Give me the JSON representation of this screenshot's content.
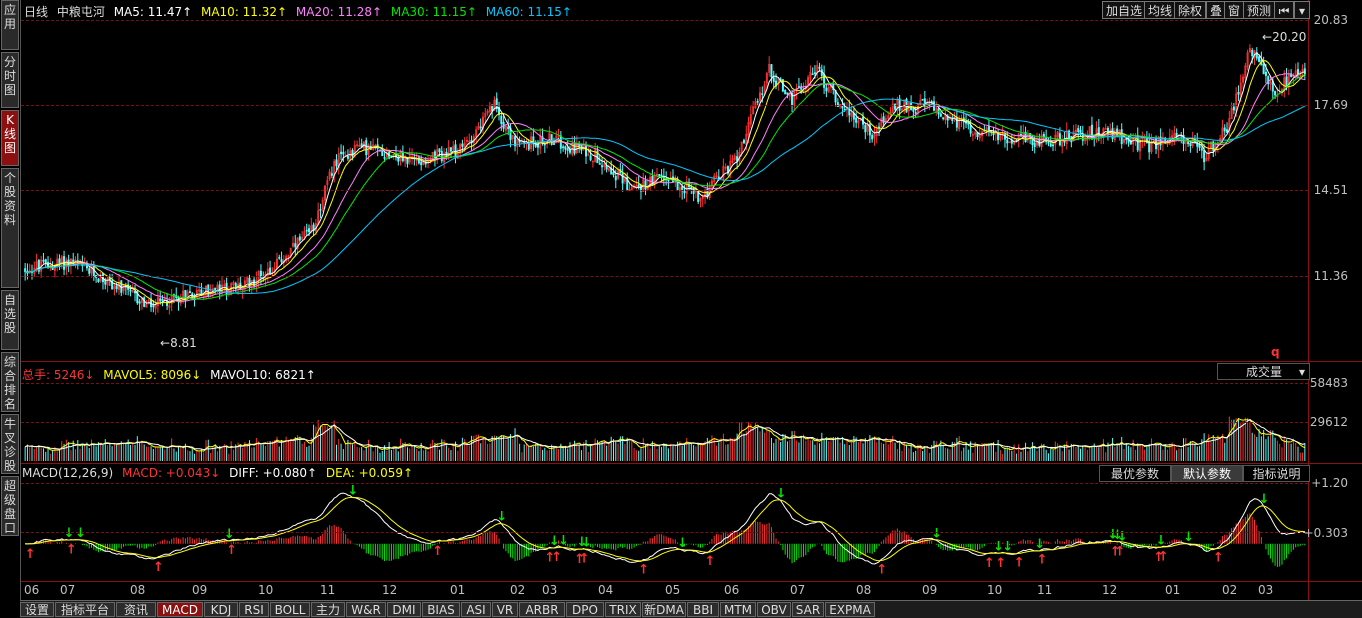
{
  "left_tabs": [
    {
      "label": "应用",
      "name": "tab-apply",
      "active": false
    },
    {
      "label": "分时图",
      "name": "tab-timeshare",
      "active": false
    },
    {
      "label": "K线图",
      "name": "tab-kline",
      "active": true
    },
    {
      "label": "个股资料",
      "name": "tab-stock-info",
      "active": false
    },
    {
      "label": "自选股",
      "name": "tab-watchlist",
      "active": false
    },
    {
      "label": "综合排名",
      "name": "tab-ranking",
      "active": false
    },
    {
      "label": "牛叉诊股",
      "name": "tab-diagnosis",
      "active": false
    },
    {
      "label": "超级盘口",
      "name": "tab-super-quote",
      "active": false
    }
  ],
  "header": {
    "period": "日线",
    "stock_name": "中粮屯河",
    "ma5": "MA5: 11.47↑",
    "ma10": "MA10: 11.32↑",
    "ma20": "MA20: 11.28↑",
    "ma30": "MA30: 11.15↑",
    "ma60": "MA60: 11.15↑"
  },
  "toolbar": {
    "add_watch": "加自选",
    "ma_line": "均线",
    "ex_rights": "除权",
    "overlay": "叠",
    "window": "窗",
    "forecast": "预测",
    "first_icon": "skip-first-icon",
    "dropdown_icon": "chevron-down-icon"
  },
  "price_axis": [
    "20.83",
    "17.69",
    "14.51",
    "11.36"
  ],
  "price_marks": {
    "high": "20.20",
    "low": "8.81",
    "q": "q"
  },
  "volume": {
    "total": "总手: 5246↓",
    "mavol5": "MAVOL5: 8096↓",
    "mavol10": "MAVOL10: 6821↑",
    "selector": "成交量",
    "axis": [
      "58483",
      "29612"
    ]
  },
  "macd": {
    "title": "MACD(12,26,9)",
    "macd": "MACD: +0.043↓",
    "diff": "DIFF: +0.080↑",
    "dea": "DEA: +0.059↑",
    "axis": [
      "+1.20",
      "+0.303"
    ],
    "btn_best": "最优参数",
    "btn_default": "默认参数",
    "btn_help": "指标说明"
  },
  "x_axis": [
    "06",
    "07",
    "08",
    "09",
    "10",
    "11",
    "12",
    "01",
    "02",
    "03",
    "04",
    "05",
    "06",
    "07",
    "08",
    "09",
    "10",
    "11",
    "12",
    "01",
    "02",
    "03"
  ],
  "bottom_tabs": [
    "设置",
    "指标平台",
    "资讯",
    "MACD",
    "KDJ",
    "RSI",
    "BOLL",
    "主力",
    "W&R",
    "DMI",
    "BIAS",
    "ASI",
    "VR",
    "ARBR",
    "DPO",
    "TRIX",
    "新DMA",
    "BBI",
    "MTM",
    "OBV",
    "SAR",
    "EXPMA"
  ],
  "bottom_active": "MACD",
  "colors": {
    "up": "#ff3232",
    "down": "#54ffff",
    "ma5": "#ffffff",
    "ma10": "#ffff00",
    "ma20": "#ff80ff",
    "ma30": "#00e600",
    "ma60": "#00c8ff",
    "grid": "#7a1010"
  },
  "chart_data": {
    "type": "candlestick",
    "price_range": [
      8.0,
      21.3
    ],
    "price_anchors": [
      [
        0,
        11.3
      ],
      [
        20,
        11.6
      ],
      [
        40,
        10.6
      ],
      [
        55,
        9.8
      ],
      [
        70,
        10.3
      ],
      [
        95,
        10.6
      ],
      [
        110,
        11.5
      ],
      [
        125,
        12.8
      ],
      [
        135,
        15.5
      ],
      [
        145,
        16.2
      ],
      [
        155,
        16.0
      ],
      [
        170,
        15.6
      ],
      [
        190,
        16.0
      ],
      [
        205,
        17.8
      ],
      [
        215,
        16.2
      ],
      [
        230,
        16.5
      ],
      [
        250,
        15.8
      ],
      [
        265,
        14.5
      ],
      [
        280,
        15.0
      ],
      [
        295,
        14.2
      ],
      [
        310,
        15.6
      ],
      [
        325,
        19.2
      ],
      [
        335,
        18.0
      ],
      [
        345,
        19.3
      ],
      [
        355,
        18.0
      ],
      [
        370,
        16.7
      ],
      [
        380,
        17.8
      ],
      [
        395,
        17.8
      ],
      [
        410,
        17.0
      ],
      [
        425,
        16.6
      ],
      [
        445,
        16.4
      ],
      [
        470,
        16.8
      ],
      [
        490,
        16.2
      ],
      [
        505,
        16.6
      ],
      [
        515,
        15.8
      ],
      [
        525,
        16.9
      ],
      [
        535,
        20.1
      ],
      [
        545,
        18.3
      ],
      [
        555,
        19.0
      ]
    ],
    "volume_range": [
      0,
      62000
    ],
    "macd_range": [
      -0.75,
      1.32
    ]
  }
}
